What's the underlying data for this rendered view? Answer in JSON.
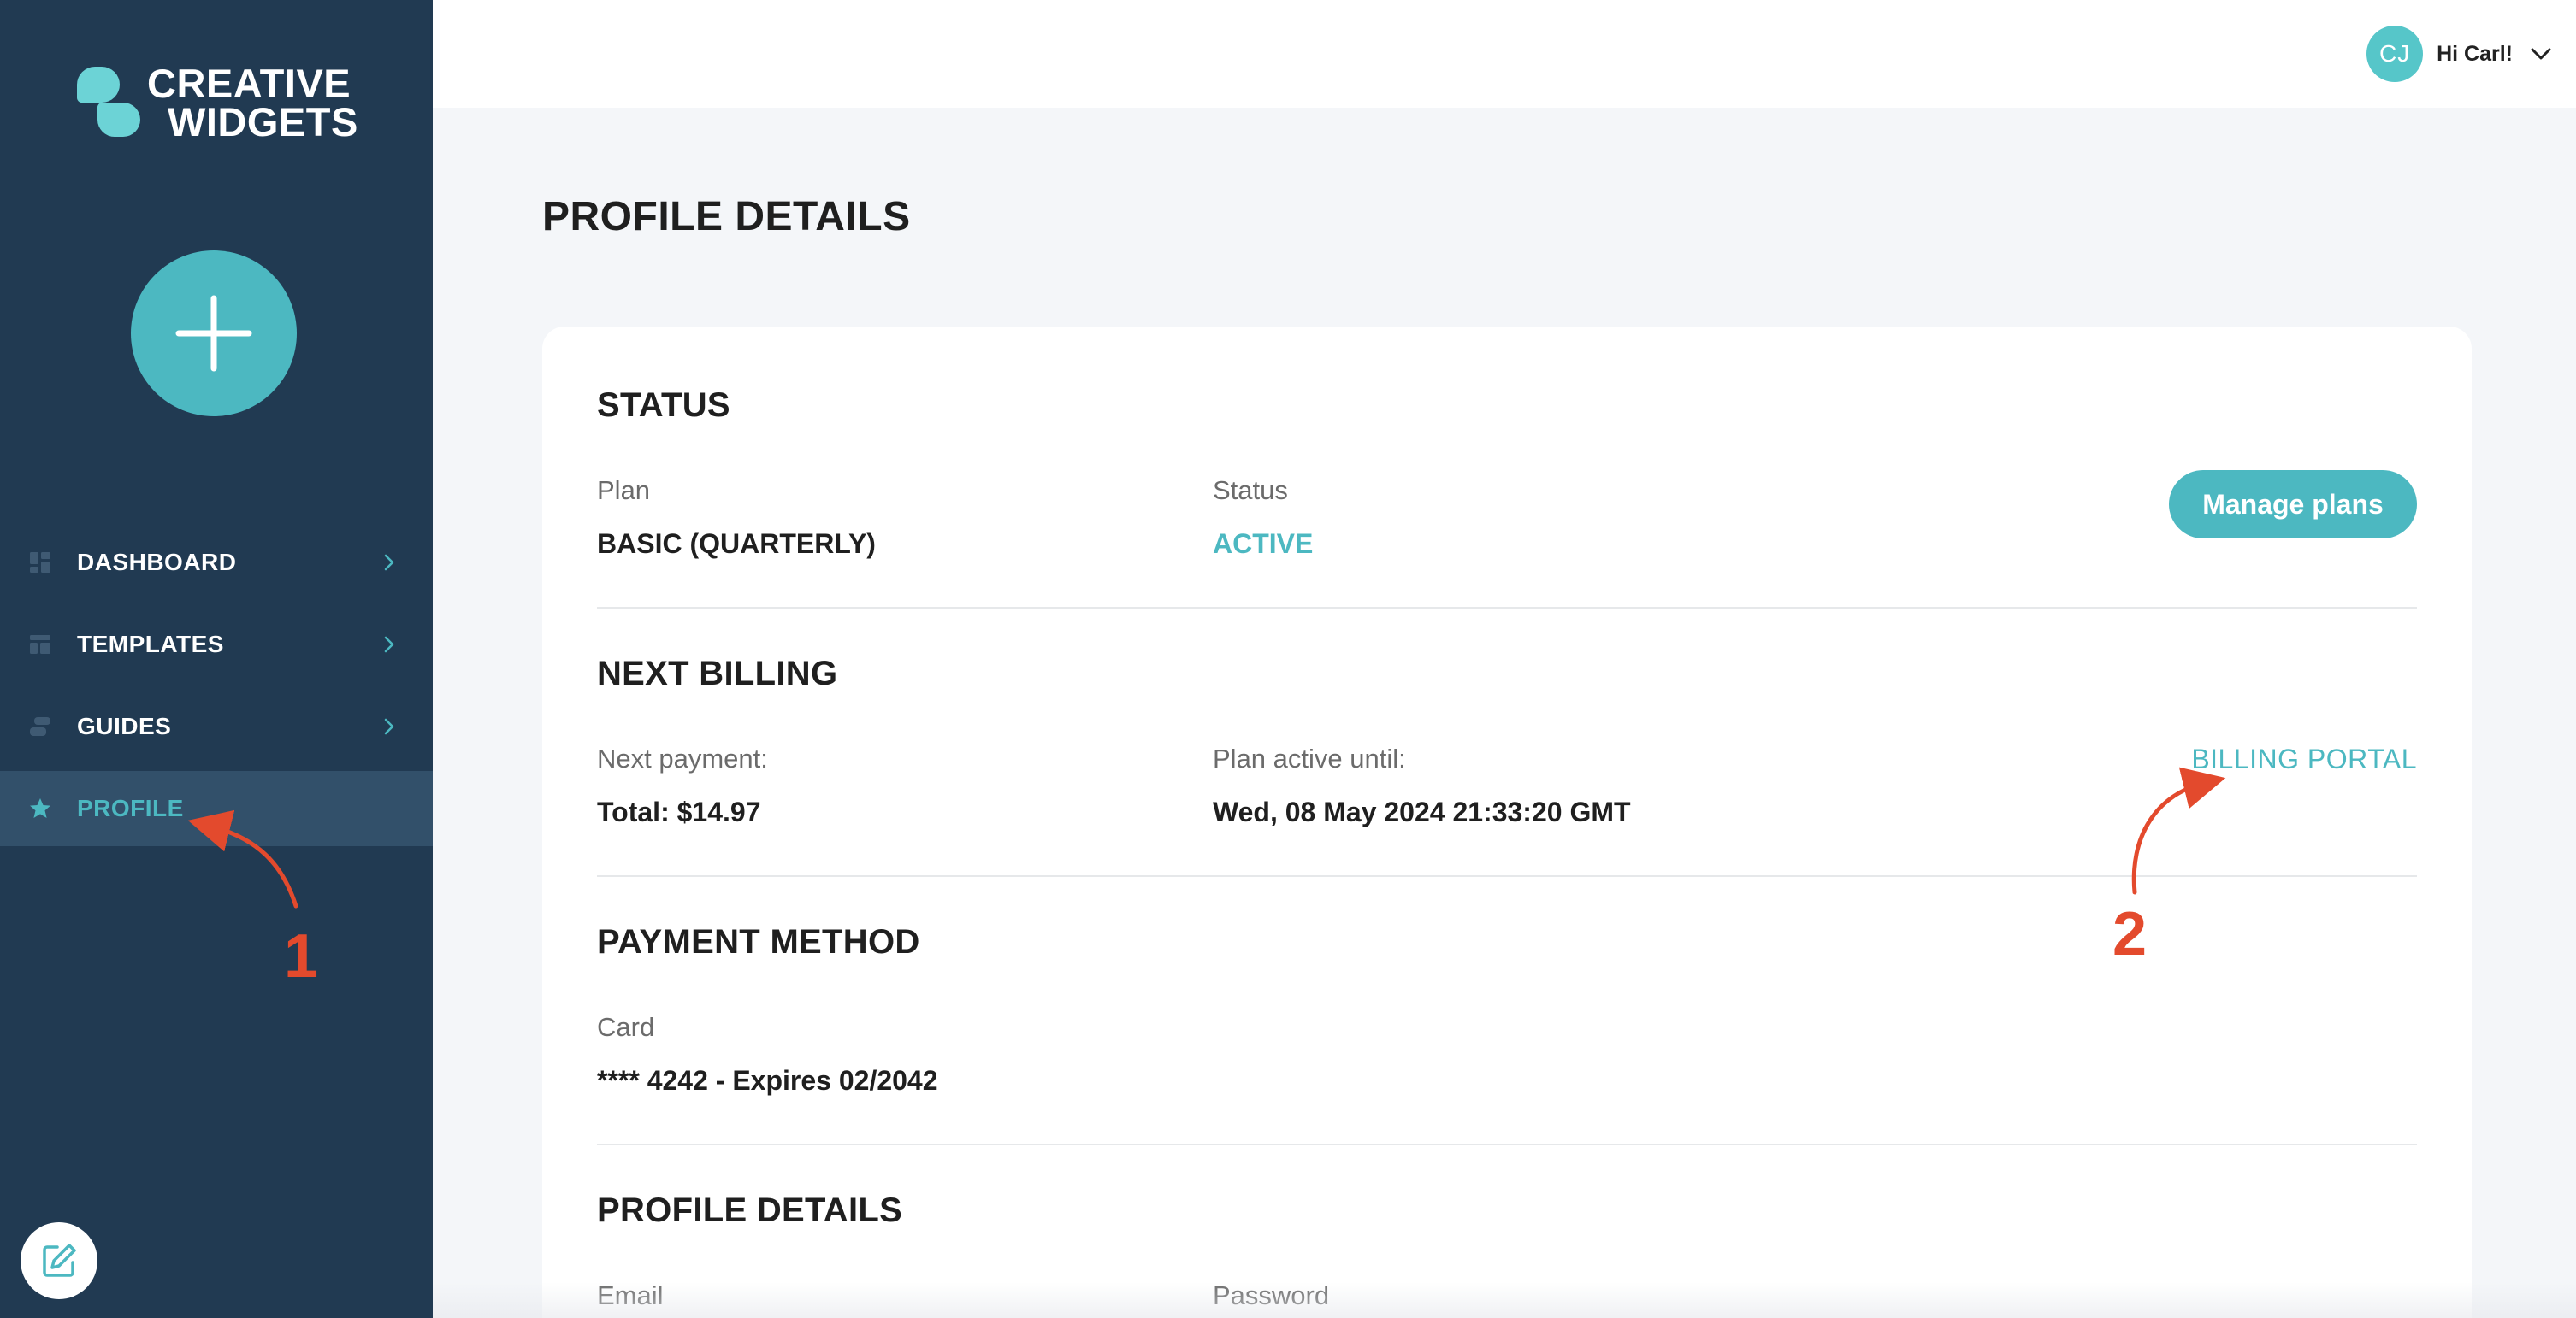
{
  "brand": {
    "line1": "CREATIVE",
    "line2": "WIDGETS"
  },
  "sidebar": {
    "items": [
      {
        "label": "DASHBOARD",
        "icon": "dashboard-icon"
      },
      {
        "label": "TEMPLATES",
        "icon": "templates-icon"
      },
      {
        "label": "GUIDES",
        "icon": "guides-icon"
      },
      {
        "label": "PROFILE",
        "icon": "star-icon",
        "active": true
      }
    ]
  },
  "user": {
    "initials": "CJ",
    "greeting": "Hi Carl!"
  },
  "page": {
    "title": "PROFILE DETAILS"
  },
  "status": {
    "title": "STATUS",
    "plan_label": "Plan",
    "plan_value": "BASIC (QUARTERLY)",
    "status_label": "Status",
    "status_value": "ACTIVE",
    "manage_button": "Manage plans"
  },
  "billing": {
    "title": "NEXT BILLING",
    "next_payment_label": "Next payment:",
    "next_payment_value": "Total: $14.97",
    "active_until_label": "Plan active until:",
    "active_until_value": "Wed, 08 May 2024 21:33:20 GMT",
    "portal_link": "BILLING PORTAL"
  },
  "payment": {
    "title": "PAYMENT METHOD",
    "card_label": "Card",
    "card_value": "**** 4242 - Expires 02/2042"
  },
  "profile": {
    "title": "PROFILE DETAILS",
    "email_label": "Email",
    "password_label": "Password"
  },
  "annotations": {
    "one": "1",
    "two": "2"
  },
  "colors": {
    "sidebar": "#213a52",
    "accent": "#4cb8c1",
    "annotation": "#e34a2d"
  }
}
